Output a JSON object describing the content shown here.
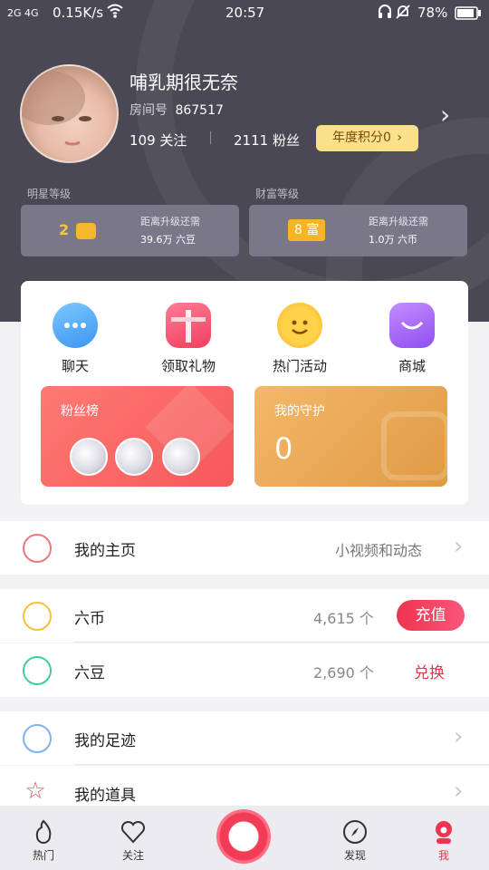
{
  "status_bar": {
    "signal": "2G 4G",
    "speed": "0.15K/s",
    "time": "20:57",
    "battery": "78%"
  },
  "profile": {
    "name": "哺乳期很无奈",
    "room_label": "房间号",
    "room_id": "867517",
    "following": "109 关注",
    "fans": "2111 粉丝",
    "annual_points": "年度积分0"
  },
  "levels": {
    "star": {
      "label": "明星等级",
      "badge": "2",
      "hint": "距离升级还需",
      "need": "39.6万 六豆"
    },
    "wealth": {
      "label": "财富等级",
      "badge": "8 富",
      "hint": "距离升级还需",
      "need": "1.0万 六币"
    }
  },
  "features": [
    {
      "label": "聊天",
      "icon": "chat-bubble-icon"
    },
    {
      "label": "领取礼物",
      "icon": "gift-box-icon"
    },
    {
      "label": "热门活动",
      "icon": "smiley-sun-icon"
    },
    {
      "label": "商城",
      "icon": "shopping-bag-icon"
    }
  ],
  "fans_rank": {
    "title": "粉丝榜"
  },
  "guard": {
    "title": "我的守护",
    "count": "0"
  },
  "rows": {
    "homepage": {
      "label": "我的主页",
      "value": "小视频和动态"
    },
    "coins": {
      "label": "六币",
      "value": "4,615 个",
      "action": "充值"
    },
    "beans": {
      "label": "六豆",
      "value": "2,690 个",
      "action": "兑换"
    },
    "footprint": {
      "label": "我的足迹"
    },
    "props": {
      "label": "我的道具"
    }
  },
  "tabs": [
    {
      "label": "热门",
      "icon": "flame-icon"
    },
    {
      "label": "关注",
      "icon": "heart-icon"
    },
    {
      "label": "发现",
      "icon": "compass-icon"
    },
    {
      "label": "我",
      "icon": "person-icon"
    }
  ],
  "colors": {
    "accent": "#f0334e",
    "header_bg": "#4a4854",
    "gold": "#fbe08a"
  }
}
